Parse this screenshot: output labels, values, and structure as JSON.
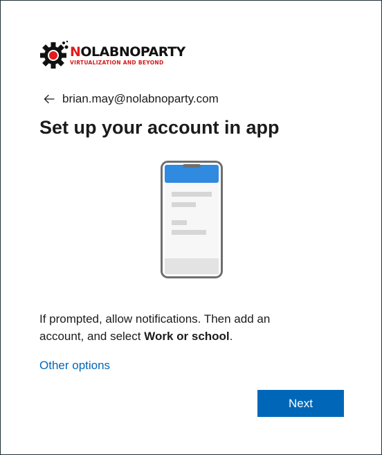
{
  "logo": {
    "title_part1": "N",
    "title_part2": "OLABNOPARTY",
    "tagline": "VIRTUALIZATION AND BEYOND"
  },
  "identity": {
    "email": "brian.may@nolabnoparty.com"
  },
  "page": {
    "title": "Set up your account in app"
  },
  "instructions": {
    "text_before": "If prompted, allow notifications. Then add an account, and select ",
    "bold": "Work or school",
    "text_after": "."
  },
  "links": {
    "other_options": "Other options"
  },
  "buttons": {
    "next": "Next"
  },
  "colors": {
    "accent": "#0067b8",
    "text": "#1b1b1b",
    "logo_red": "#e21b1b",
    "phone_header": "#2f8ae0"
  },
  "icons": {
    "back": "arrow-left-icon",
    "illustration": "smartphone-illustration"
  }
}
